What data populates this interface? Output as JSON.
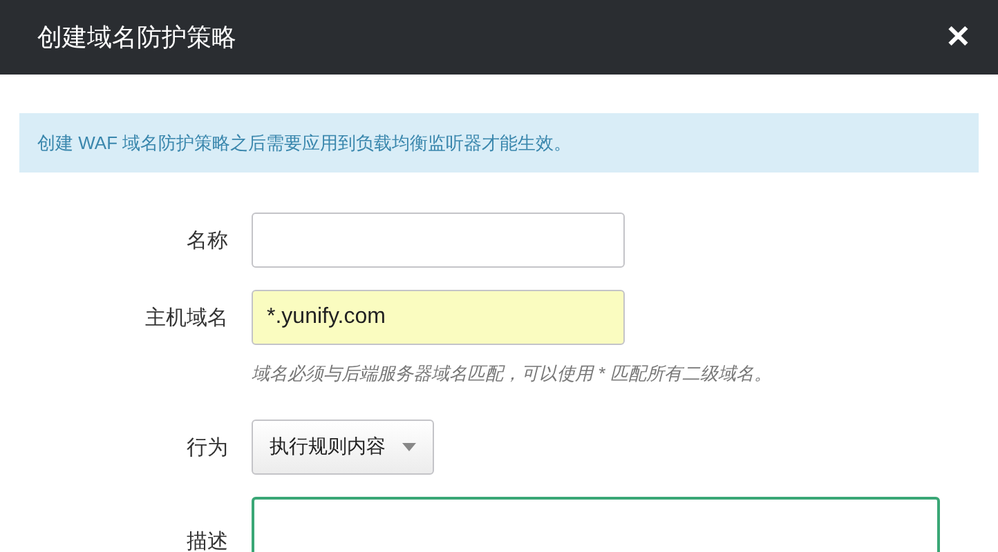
{
  "dialog": {
    "title": "创建域名防护策略",
    "close": "✕"
  },
  "notice": "创建 WAF 域名防护策略之后需要应用到负载均衡监听器才能生效。",
  "fields": [
    {
      "kind": "text",
      "label": "名称",
      "highlighted": false,
      "focused": false
    },
    {
      "kind": "text",
      "label": "主机域名",
      "value": "*.yunify.com",
      "highlighted": true,
      "focused": false,
      "hint": "域名必须与后端服务器域名匹配，可以使用 * 匹配所有二级域名。"
    },
    {
      "kind": "select",
      "label": "行为",
      "value": "执行规则内容"
    },
    {
      "kind": "textarea",
      "label": "描述",
      "highlighted": false,
      "focused": true
    }
  ]
}
